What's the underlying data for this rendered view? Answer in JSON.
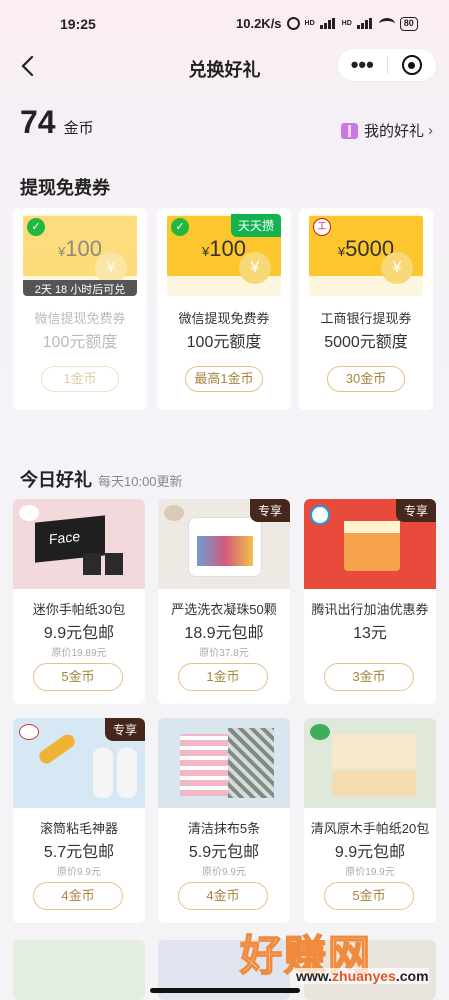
{
  "status": {
    "time": "19:25",
    "speed": "10.2K/s",
    "net1": "HD",
    "net2": "HD",
    "battery": "80"
  },
  "nav": {
    "title": "兑换好礼",
    "more": "•••"
  },
  "account": {
    "coins": "74",
    "coin_unit": "金币",
    "my_gifts": "我的好礼"
  },
  "vouchers": {
    "section_title": "提现免费券",
    "items": [
      {
        "amount": "100",
        "currency": "¥",
        "yen": "¥",
        "logo": "✓",
        "countdown": "2天 18 小时后可兑",
        "name": "微信提现免费券",
        "quota": "100元额度",
        "button": "1金币"
      },
      {
        "amount": "100",
        "currency": "¥",
        "yen": "¥",
        "logo": "✓",
        "ribbon": "天天攒",
        "name": "微信提现免费券",
        "quota": "100元额度",
        "button": "最高1金币"
      },
      {
        "amount": "5000",
        "currency": "¥",
        "yen": "¥",
        "logo": "工",
        "name": "工商银行提现券",
        "quota": "5000元额度",
        "button": "30金币"
      }
    ]
  },
  "daily": {
    "section_title": "今日好礼",
    "subtitle": "每天10:00更新",
    "items": [
      {
        "name": "迷你手帕纸30包",
        "price": "9.9元包邮",
        "original": "原价19.89元",
        "button": "5金币",
        "img_text": "Face"
      },
      {
        "name": "严选洗衣凝珠50颗",
        "price": "18.9元包邮",
        "original": "原价37.8元",
        "button": "1金币",
        "badge": "专享"
      },
      {
        "name": "腾讯出行加油优惠券",
        "price": "13元",
        "button": "3金币",
        "badge": "专享"
      },
      {
        "name": "滚筒粘毛神器",
        "price": "5.7元包邮",
        "original": "原价9.9元",
        "button": "4金币",
        "badge": "专享"
      },
      {
        "name": "清洁抹布5条",
        "price": "5.9元包邮",
        "original": "原价9.9元",
        "button": "4金币"
      },
      {
        "name": "清风原木手帕纸20包",
        "price": "9.9元包邮",
        "original": "原价19.9元",
        "button": "5金币"
      }
    ]
  },
  "watermark": {
    "brand": "好赚网",
    "url_a": "www.",
    "url_b": "zhuanyes",
    "url_c": ".com"
  },
  "colors": {
    "accent": "#a8843c",
    "ticket": "#fcc62c",
    "ribbon": "#15b34f",
    "badge": "#45281b"
  }
}
